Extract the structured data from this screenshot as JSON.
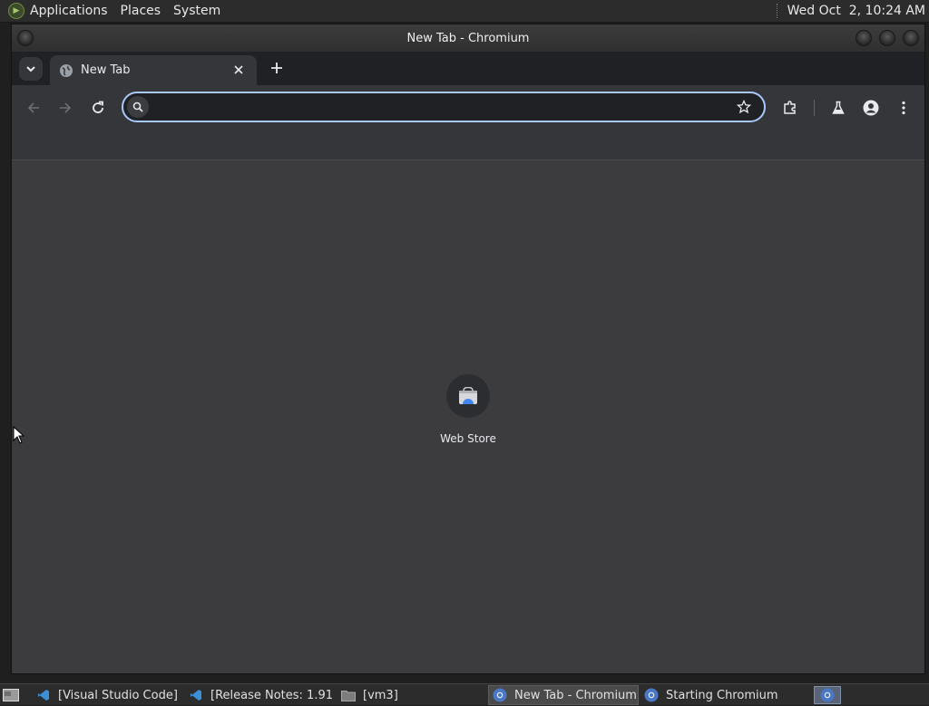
{
  "top_panel": {
    "menus": [
      "Applications",
      "Places",
      "System"
    ],
    "clock": "Wed Oct  2, 10:24 AM"
  },
  "window": {
    "title": "New Tab - Chromium"
  },
  "tabs": [
    {
      "title": "New Tab",
      "favicon": "globe-icon",
      "active": true
    }
  ],
  "omnibox": {
    "value": "",
    "placeholder": ""
  },
  "shortcuts": [
    {
      "label": "Web Store",
      "icon": "web-store-icon"
    }
  ],
  "taskbar": {
    "tasks": [
      {
        "label": "[Visual Studio Code]",
        "icon": "vscode-icon",
        "active": false
      },
      {
        "label": "[Release Notes: 1.91…",
        "icon": "vscode-icon",
        "active": false
      },
      {
        "label": "[vm3]",
        "icon": "folder-icon",
        "active": false
      },
      {
        "label": "New Tab - Chromium",
        "icon": "chromium-icon",
        "active": true
      },
      {
        "label": "Starting Chromium",
        "icon": "chromium-icon",
        "active": false
      }
    ]
  },
  "colors": {
    "omnibox_focus": "#a8c7fa",
    "toolbar": "#35363a",
    "tabstrip": "#202124",
    "content_bg": "#3c3c3f"
  }
}
